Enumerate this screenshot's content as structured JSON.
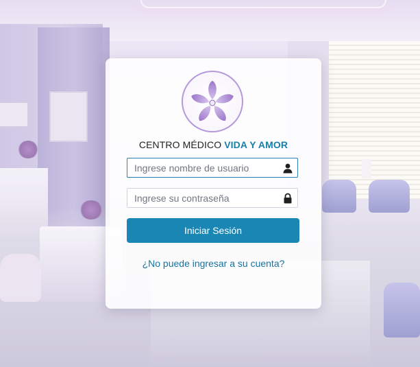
{
  "brand": {
    "name_prefix": "CENTRO MÉDICO",
    "name_accent": "VIDA Y AMOR",
    "accent_color": "#1781a8",
    "logo_icon": "orchid-flower-icon"
  },
  "login": {
    "username_placeholder": "Ingrese nombre de usuario",
    "username_value": "",
    "username_icon": "user-icon",
    "password_placeholder": "Ingrese su contraseña",
    "password_value": "",
    "password_icon": "lock-icon",
    "submit_label": "Iniciar Sesión",
    "submit_color": "#1a86b4",
    "help_link": "¿No puede ingresar a su cuenta?"
  }
}
